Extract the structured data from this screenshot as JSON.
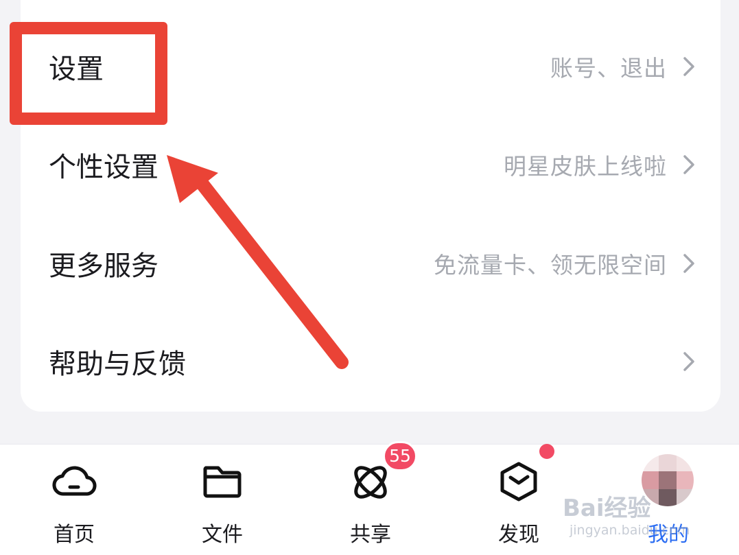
{
  "settings_list": [
    {
      "label": "设置",
      "hint": "账号、退出"
    },
    {
      "label": "个性设置",
      "hint": "明星皮肤上线啦"
    },
    {
      "label": "更多服务",
      "hint": "免流量卡、领无限空间"
    },
    {
      "label": "帮助与反馈",
      "hint": ""
    }
  ],
  "tabbar": {
    "tabs": [
      {
        "label": "首页",
        "icon": "cloud-icon"
      },
      {
        "label": "文件",
        "icon": "folder-icon"
      },
      {
        "label": "共享",
        "icon": "orbit-icon",
        "badge": "55"
      },
      {
        "label": "发现",
        "icon": "cube-clock-icon",
        "dot": true
      },
      {
        "label": "我的",
        "icon": "avatar",
        "active": true
      }
    ]
  },
  "annotation": {
    "highlight_color": "#ea4336",
    "target_item": "设置"
  },
  "watermark": {
    "main": "Bai经验",
    "sub": "jingyan.baidu.com"
  },
  "colors": {
    "accent": "#2a6cf2",
    "badge": "#f24a64",
    "hint_text": "#a6a9b0"
  }
}
